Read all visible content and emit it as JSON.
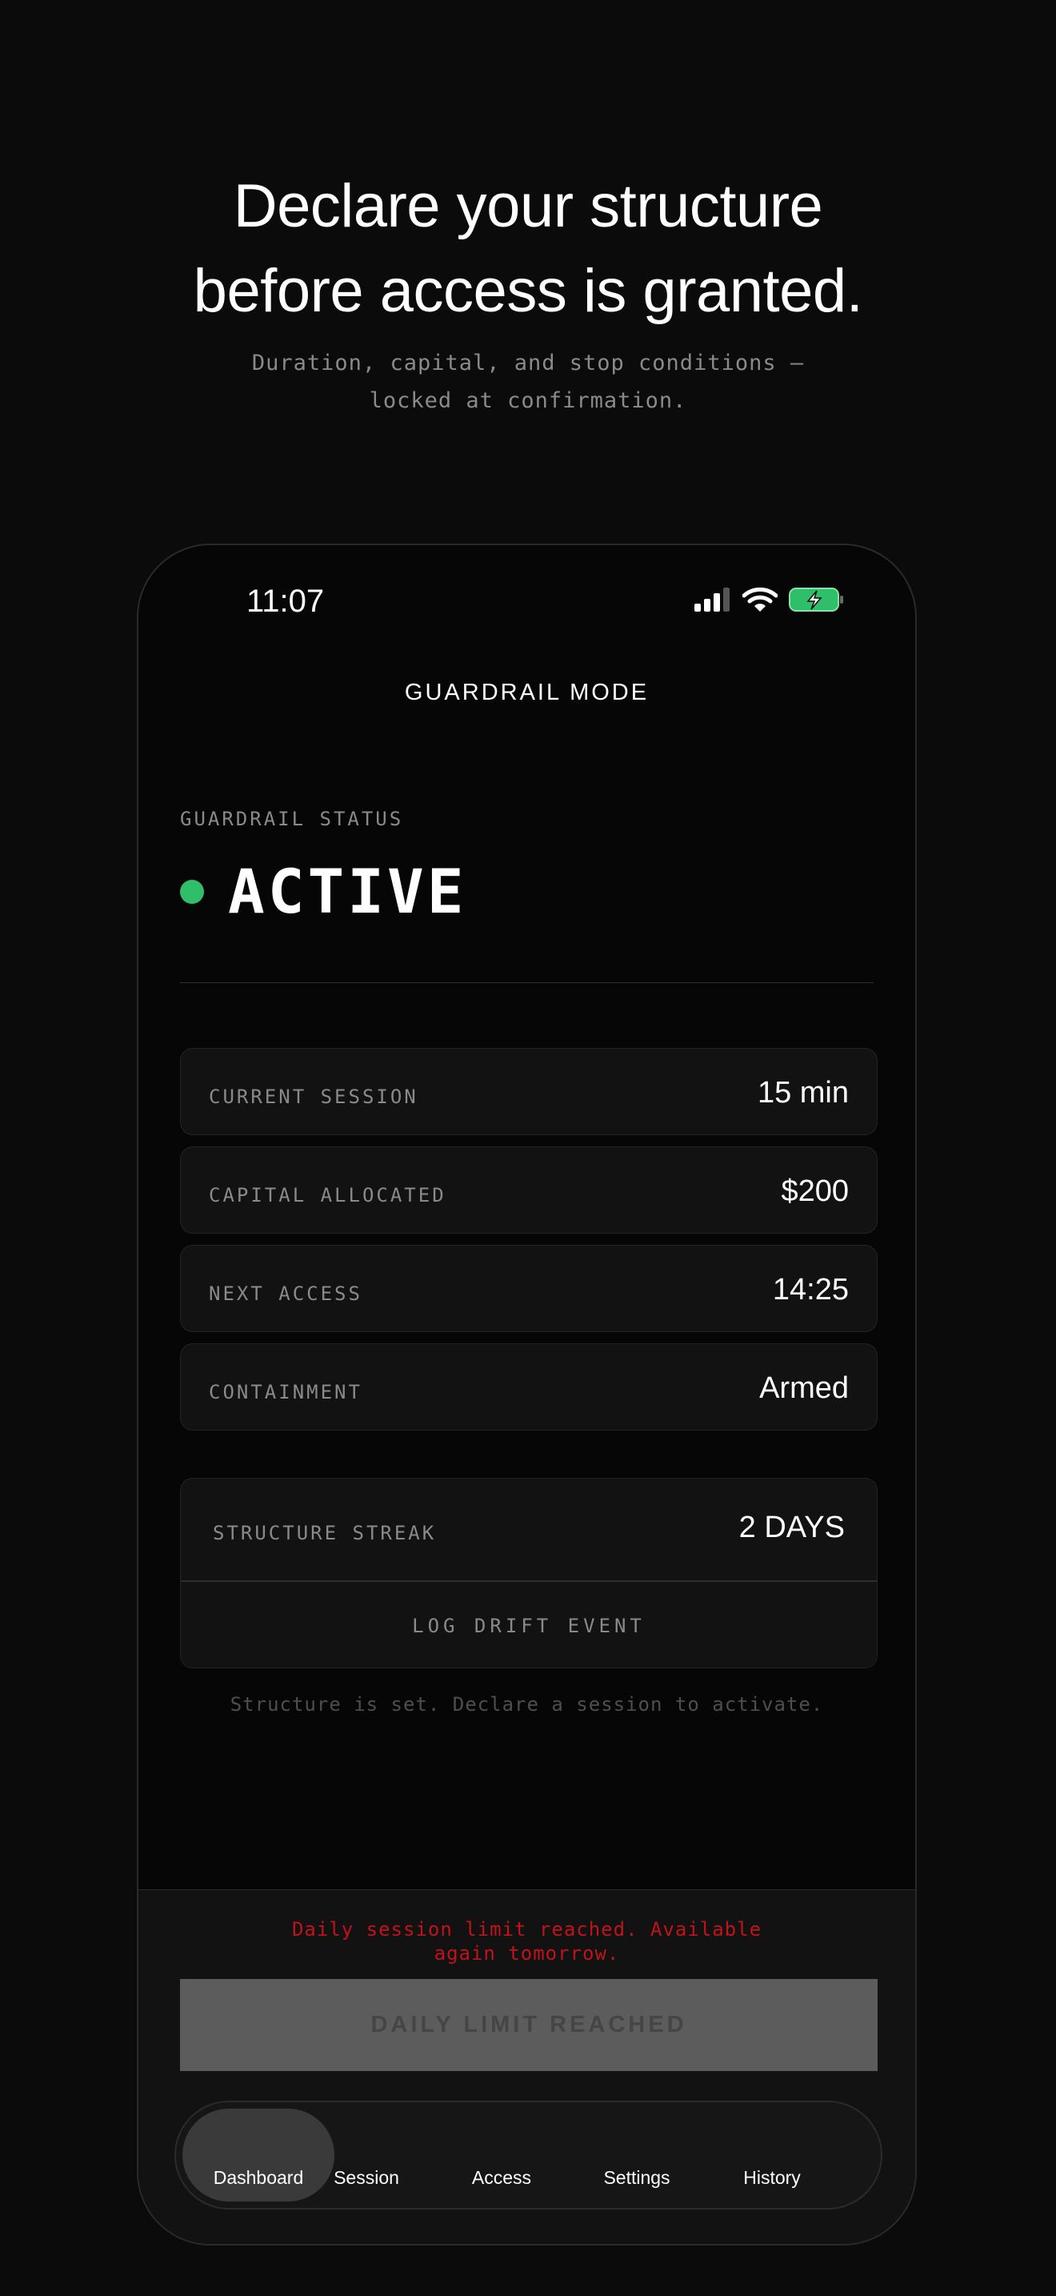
{
  "hero": {
    "headline_line1": "Declare your structure",
    "headline_line2": "before access is granted.",
    "subhead_line1": "Duration, capital, and stop conditions —",
    "subhead_line2": "locked at confirmation."
  },
  "status_bar": {
    "time": "11:07",
    "icons": [
      "cellular-signal-icon",
      "wifi-icon",
      "battery-charging-icon"
    ],
    "battery_color": "#2fbf6b"
  },
  "header": {
    "title": "GUARDRAIL MODE"
  },
  "guardrail": {
    "label": "GUARDRAIL STATUS",
    "value": "ACTIVE",
    "indicator_color": "#2fbf6b"
  },
  "stats": [
    {
      "label": "CURRENT SESSION",
      "value": "15 min"
    },
    {
      "label": "CAPITAL ALLOCATED",
      "value": "$200"
    },
    {
      "label": "NEXT ACCESS",
      "value": "14:25"
    },
    {
      "label": "CONTAINMENT",
      "value": "Armed"
    }
  ],
  "streak": {
    "label": "STRUCTURE STREAK",
    "value": "2 DAYS",
    "drift_button": "LOG DRIFT EVENT"
  },
  "hint": "Structure is set. Declare a session to activate.",
  "footer": {
    "limit_message_line1": "Daily session limit reached. Available",
    "limit_message_line2": "again tomorrow.",
    "limit_message_color": "#c0131a",
    "limit_button": "DAILY LIMIT REACHED"
  },
  "tabs": [
    {
      "label": "Dashboard",
      "active": true
    },
    {
      "label": "Session",
      "active": false
    },
    {
      "label": "Access",
      "active": false
    },
    {
      "label": "Settings",
      "active": false
    },
    {
      "label": "History",
      "active": false
    }
  ]
}
